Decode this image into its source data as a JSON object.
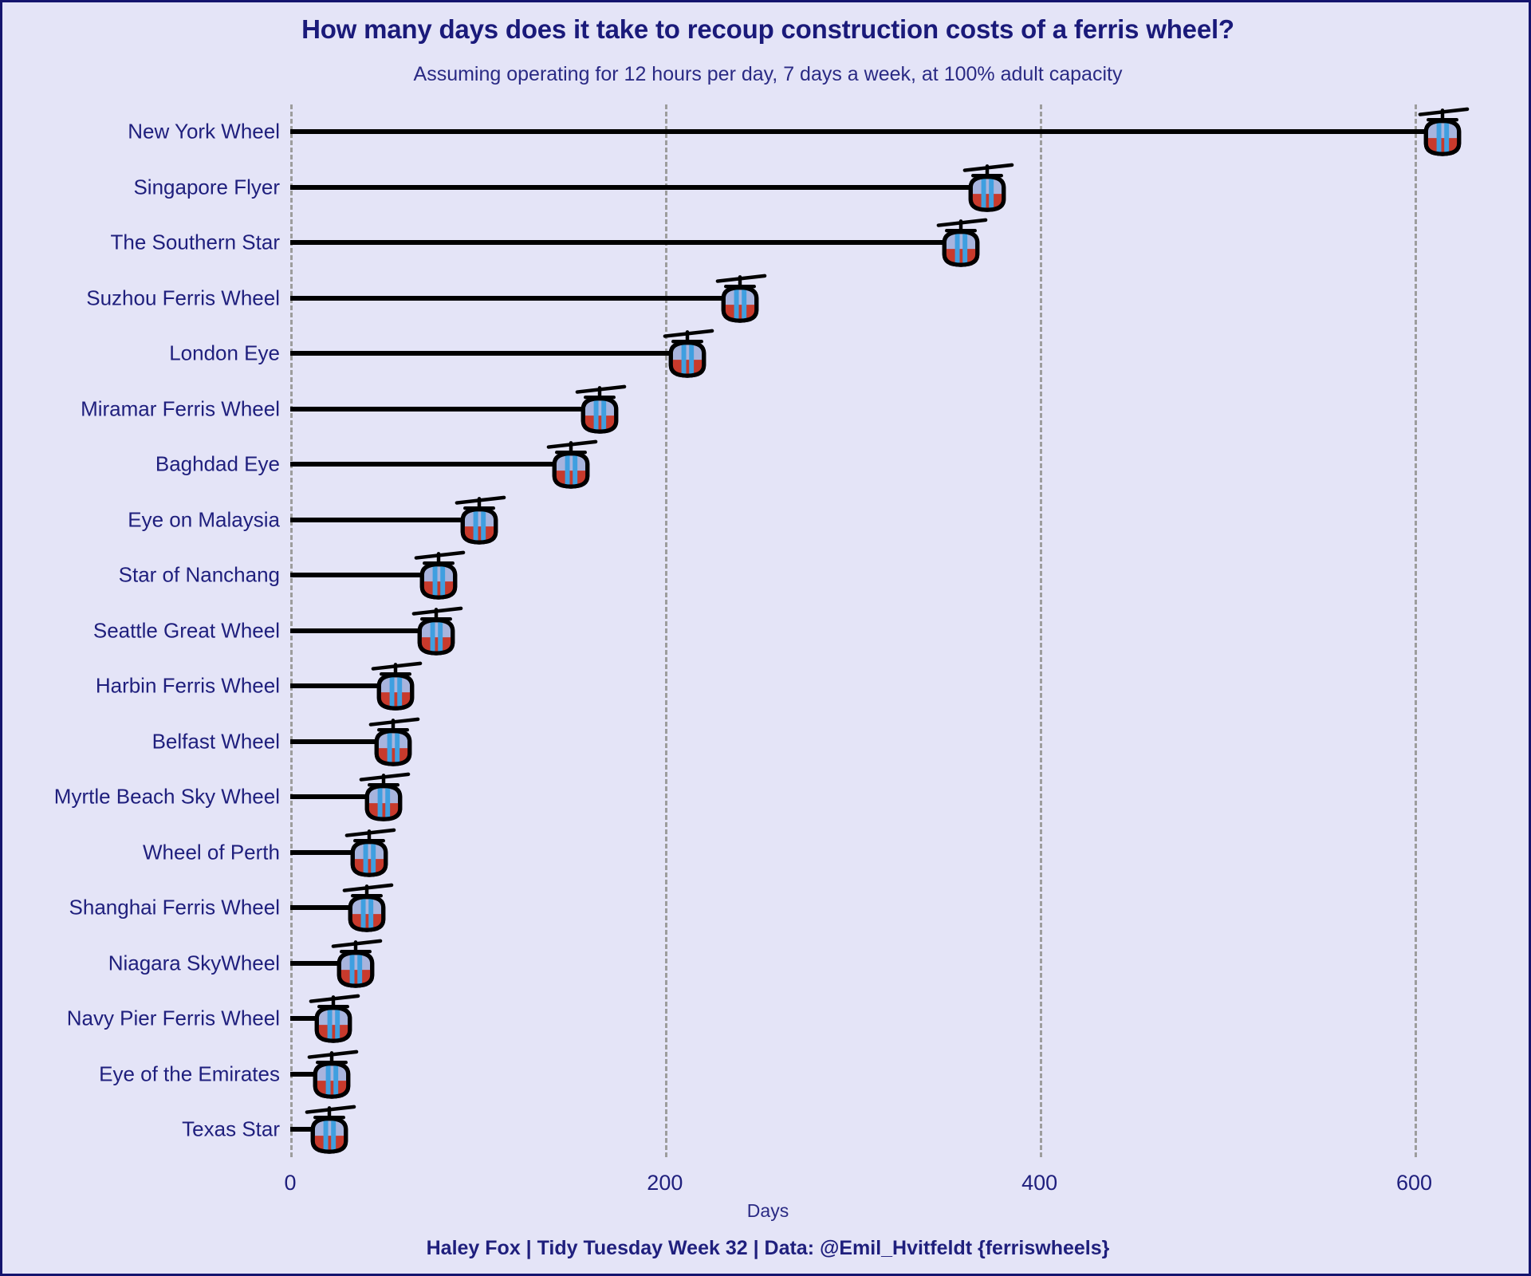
{
  "chart_data": {
    "type": "bar",
    "orientation": "horizontal",
    "title": "How many days does it take to recoup construction costs of a ferris wheel?",
    "subtitle": "Assuming operating for 12 hours per day, 7 days a week, at 100% adult capacity",
    "caption": "Haley Fox |  Tidy Tuesday Week 32 | Data: @Emil_Hvitfeldt {ferriswheels}",
    "xlabel": "Days",
    "ylabel": "",
    "xlim": [
      0,
      630
    ],
    "xticks": [
      0,
      200,
      400,
      600
    ],
    "xticklabels": [
      "0",
      "200",
      "400",
      "600"
    ],
    "grid": "vertical-dashed",
    "legend": "none",
    "marker": "cable-car-gondola",
    "categories": [
      "New York Wheel",
      "Singapore Flyer",
      "The Southern Star",
      "Suzhou Ferris Wheel",
      "London Eye",
      "Miramar Ferris Wheel",
      "Baghdad Eye",
      "Eye on Malaysia",
      "Star of Nanchang",
      "Seattle Great Wheel",
      "Harbin Ferris Wheel",
      "Belfast Wheel",
      "Myrtle Beach Sky Wheel",
      "Wheel of Perth",
      "Shanghai Ferris Wheel",
      "Niagara SkyWheel",
      "Navy Pier Ferris Wheel",
      "Eye of the Emirates",
      "Texas Star"
    ],
    "values": [
      615,
      372,
      358,
      240,
      212,
      165,
      150,
      101,
      79,
      78,
      56,
      55,
      50,
      42,
      41,
      35,
      23,
      22,
      21
    ]
  },
  "colors": {
    "background": "#e4e4f7",
    "border": "#14146e",
    "text": "#1f1f7d",
    "title": "#1a1a7a",
    "segment": "#000000",
    "gridline": "#9d9d9d",
    "gondola_blue": "#3f9fe0",
    "gondola_lightblue": "#a8b4dd",
    "gondola_red": "#c83a2c",
    "gondola_outline": "#000000"
  }
}
